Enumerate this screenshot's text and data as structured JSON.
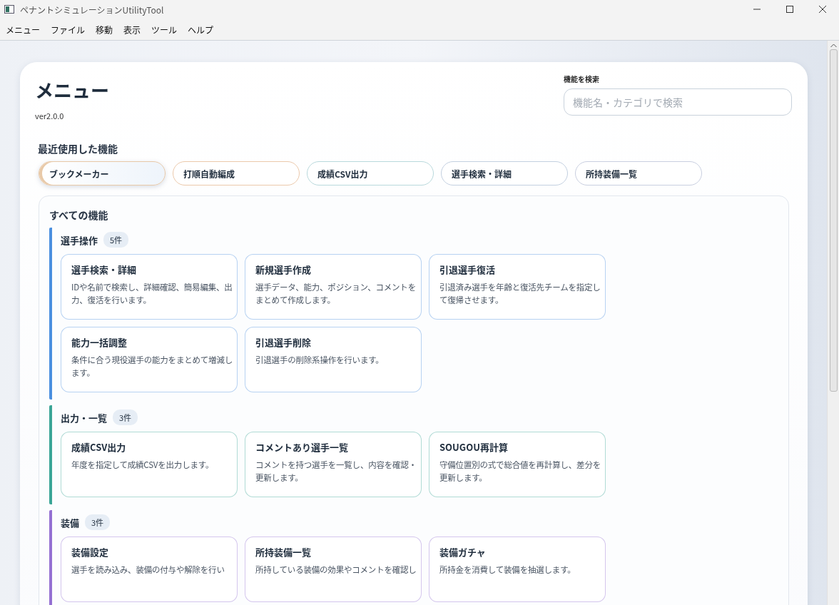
{
  "window": {
    "title": "ペナントシミュレーションUtilityTool"
  },
  "menu_bar": [
    "メニュー",
    "ファイル",
    "移動",
    "表示",
    "ツール",
    "ヘルプ"
  ],
  "page": {
    "title": "メニュー",
    "version": "ver2.0.0"
  },
  "search": {
    "label": "機能を検索",
    "placeholder": "機能名・カテゴリで検索"
  },
  "recent": {
    "heading": "最近使用した機能",
    "items": [
      {
        "label": "ブックメーカー",
        "selected": true,
        "color": "#e8c9a8"
      },
      {
        "label": "打順自動編成",
        "selected": false,
        "color": "#ecc9ab"
      },
      {
        "label": "成績CSV出力",
        "selected": false,
        "color": "#b9d9dc"
      },
      {
        "label": "選手検索・詳細",
        "selected": false,
        "color": "#c3d0e0"
      },
      {
        "label": "所持装備一覧",
        "selected": false,
        "color": "#c9cfe0"
      }
    ]
  },
  "all": {
    "heading": "すべての機能",
    "categories": [
      {
        "name": "選手操作",
        "count": "5件",
        "color": "#4a8fdf",
        "items": [
          {
            "title": "選手検索・詳細",
            "description": "IDや名前で検索し、詳細確認、簡易編集、出力、復活を行います。"
          },
          {
            "title": "新規選手作成",
            "description": "選手データ、能力、ポジション、コメントをまとめて作成します。"
          },
          {
            "title": "引退選手復活",
            "description": "引退済み選手を年齢と復活先チームを指定して復帰させます。"
          },
          {
            "title": "能力一括調整",
            "description": "条件に合う現役選手の能力をまとめて増減します。"
          },
          {
            "title": "引退選手削除",
            "description": "引退選手の削除系操作を行います。"
          }
        ]
      },
      {
        "name": "出力・一覧",
        "count": "3件",
        "color": "#3aa596",
        "items": [
          {
            "title": "成績CSV出力",
            "description": "年度を指定して成績CSVを出力します。"
          },
          {
            "title": "コメントあり選手一覧",
            "description": "コメントを持つ選手を一覧し、内容を確認・更新します。"
          },
          {
            "title": "SOUGOU再計算",
            "description": "守備位置別の式で総合値を再計算し、差分を更新します。"
          }
        ]
      },
      {
        "name": "装備",
        "count": "3件",
        "color": "#9470d2",
        "items": [
          {
            "title": "装備設定",
            "description": "選手を読み込み、装備の付与や解除を行い"
          },
          {
            "title": "所持装備一覧",
            "description": "所持している装備の効果やコメントを確認し"
          },
          {
            "title": "装備ガチャ",
            "description": "所持金を消費して装備を抽選します。"
          }
        ]
      }
    ]
  }
}
